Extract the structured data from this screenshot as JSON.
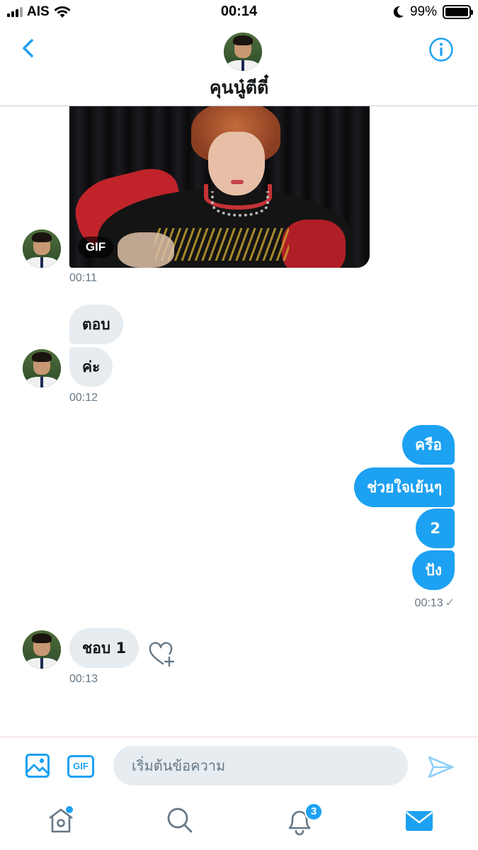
{
  "status_bar": {
    "carrier": "AIS",
    "time": "00:14",
    "battery_percent": "99%",
    "battery_level": 0.99,
    "icons": [
      "signal-icon",
      "wifi-icon",
      "moon-icon",
      "battery-icon"
    ]
  },
  "header": {
    "title": "คุนนู๋ตีตี๋",
    "back_icon": "chevron-left-icon",
    "info_icon": "info-icon"
  },
  "messages": {
    "gif_label": "GIF",
    "gif_time": "00:11",
    "incoming_1": "ตอบ",
    "incoming_2": "ค่ะ",
    "incoming_time": "00:12",
    "outgoing_1": "ครือ",
    "outgoing_2": "ช่วยใจเย้นๆ",
    "outgoing_3": "2",
    "outgoing_4": "ปัง",
    "outgoing_time": "00:13",
    "outgoing_status": "✓",
    "incoming_3": "ชอบ 1",
    "incoming_3_time": "00:13",
    "like_icon": "heart-plus-icon"
  },
  "composer": {
    "placeholder": "เริ่มต้นข้อความ",
    "gif_button": "GIF",
    "media_icon": "image-icon",
    "send_icon": "send-icon"
  },
  "tabbar": {
    "items": [
      "home",
      "search",
      "notifications",
      "messages"
    ],
    "notification_count": "3"
  },
  "colors": {
    "accent": "#1da1f2",
    "incoming_bubble": "#e6ecf0",
    "text": "#14171a",
    "muted": "#657786"
  }
}
